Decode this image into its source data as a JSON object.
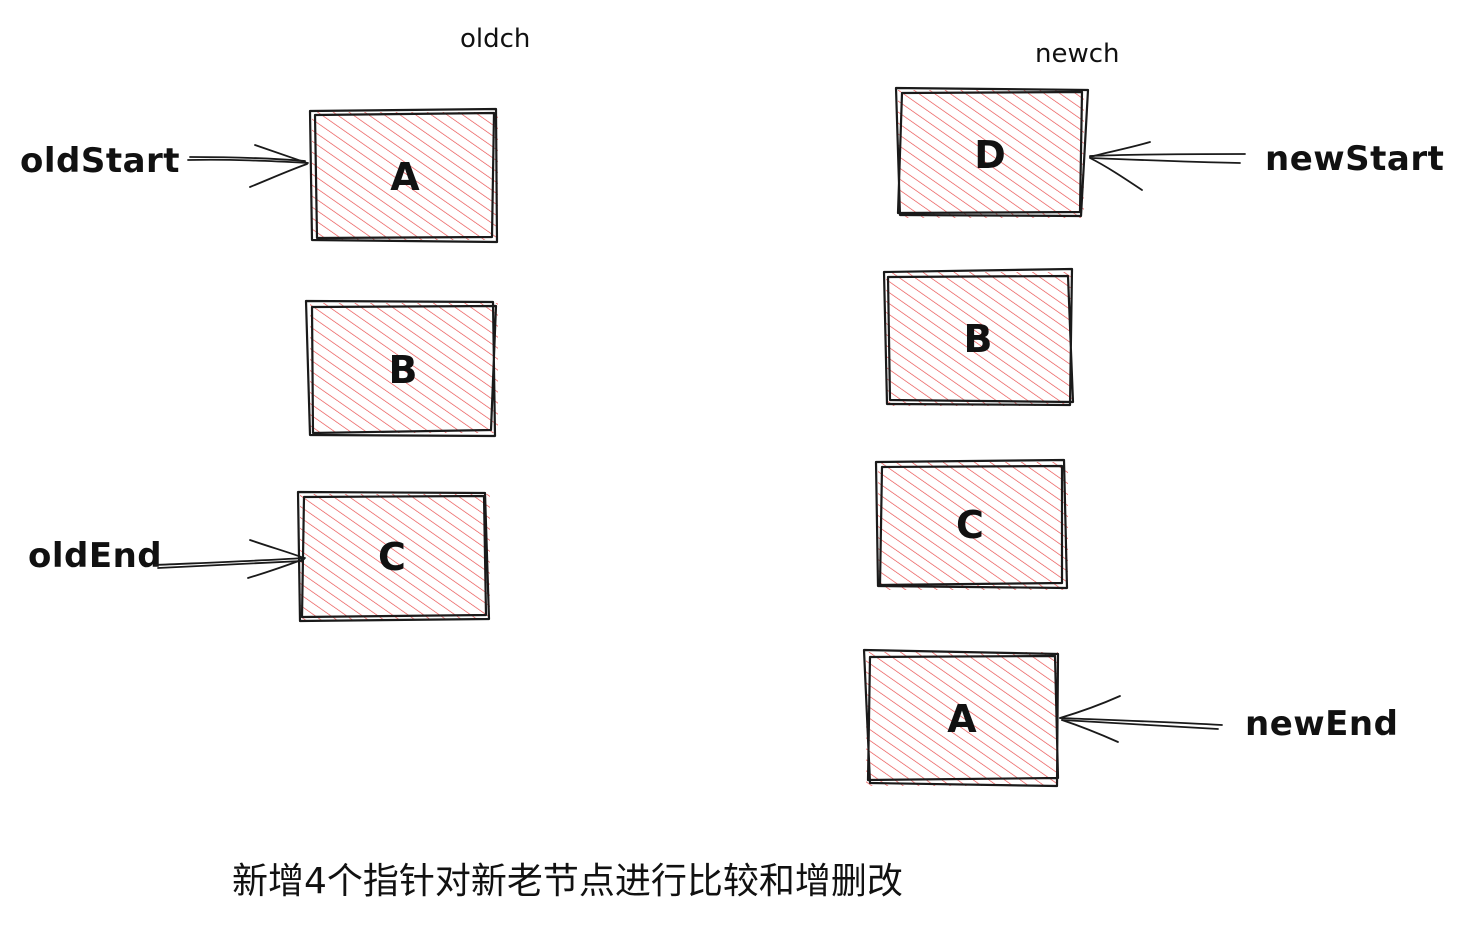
{
  "old_list": {
    "title": "oldch",
    "nodes": [
      "A",
      "B",
      "C"
    ],
    "start_pointer": "oldStart",
    "end_pointer": "oldEnd"
  },
  "new_list": {
    "title": "newch",
    "nodes": [
      "D",
      "B",
      "C",
      "A"
    ],
    "start_pointer": "newStart",
    "end_pointer": "newEnd"
  },
  "caption": "新增4个指针对新老节点进行比较和增删改",
  "colors": {
    "node_hatch": "#e84545",
    "outline": "#1a1a1a"
  }
}
